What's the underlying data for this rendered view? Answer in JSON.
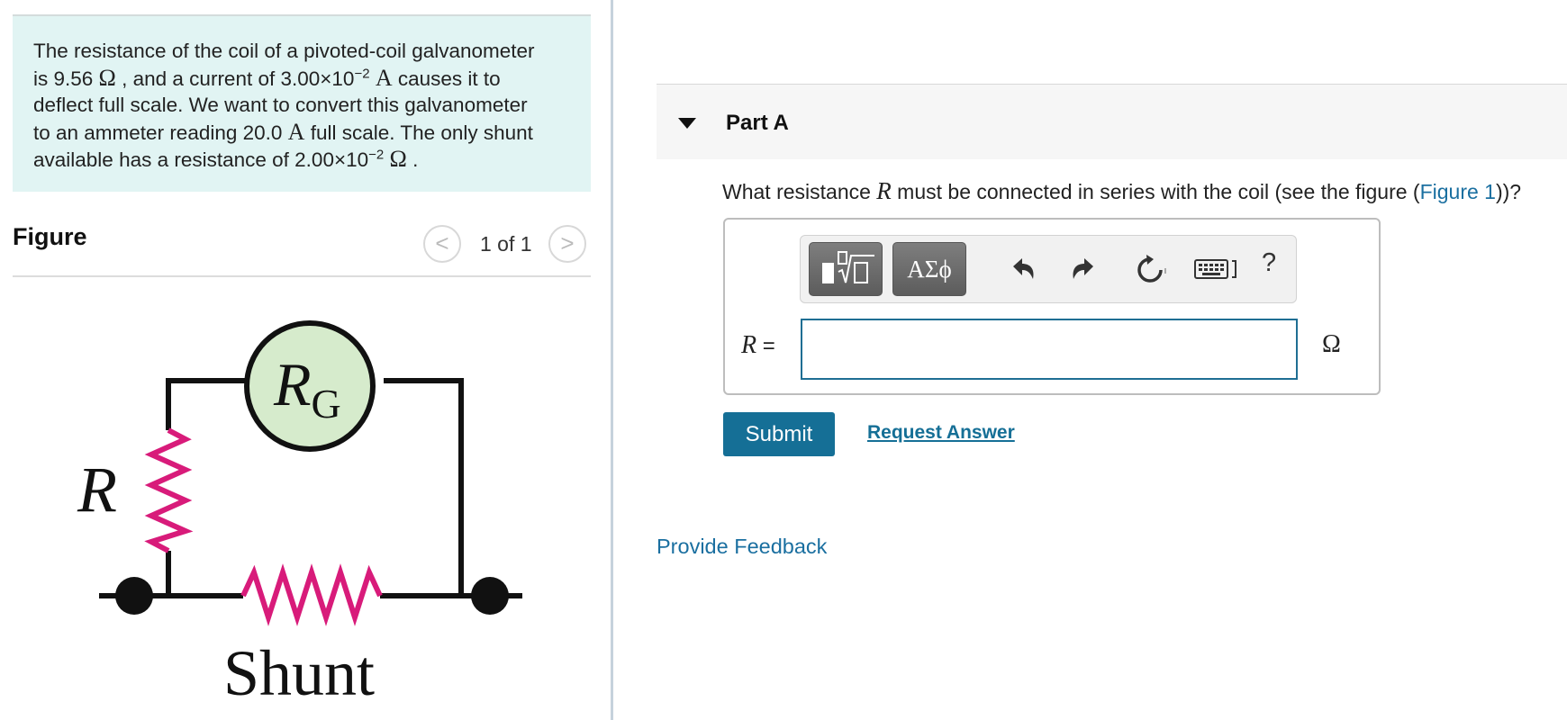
{
  "problem": {
    "line1": "The resistance of the coil of a pivoted-coil galvanometer",
    "line2_pre": "is 9.56 ",
    "ohm": "Ω",
    "line2_mid": " , and a current of 3.00×10",
    "exp_neg2": "−2",
    "amp": "A",
    "line2_post": " causes it to",
    "line3": "deflect full scale. We want to convert this galvanometer",
    "line4_pre": "to an ammeter reading 20.0 ",
    "line4_post": " full scale. The only shunt",
    "line5_pre": "available has a resistance of 2.00×10",
    "line5_post": " ."
  },
  "figure": {
    "title": "Figure",
    "counter": "1 of 1",
    "prev_glyph": "<",
    "next_glyph": ">",
    "labels": {
      "galvanometer": "R",
      "galvanometer_sub": "G",
      "resistor": "R",
      "shunt": "Shunt"
    },
    "colors": {
      "wire": "#111111",
      "resistor": "#d81b7a",
      "galvanometer_fill": "#d6ebcc"
    }
  },
  "part": {
    "title": "Part A",
    "question_pre": "What resistance ",
    "question_var": "R",
    "question_mid": " must be connected in series with the coil (see the figure (",
    "figure_link": "Figure 1",
    "question_post": "))?"
  },
  "toolbar": {
    "symbols_label": "ΑΣϕ",
    "help_label": "?",
    "icons": [
      "templates-icon",
      "undo-icon",
      "redo-icon",
      "reset-icon",
      "keyboard-icon",
      "help-icon"
    ]
  },
  "answer": {
    "var": "R",
    "equals": " =",
    "value": "",
    "unit": "Ω"
  },
  "actions": {
    "submit_label": "Submit",
    "request_answer_label": "Request Answer",
    "feedback_label": "Provide Feedback"
  },
  "colors": {
    "problem_bg": "#e1f4f3",
    "primary": "#156f96",
    "link": "#1a6fa0",
    "part_header_bg": "#f6f6f6"
  }
}
